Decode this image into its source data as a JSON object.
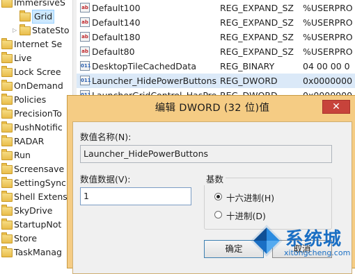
{
  "tree": {
    "items": [
      {
        "label": "ImmersiveS",
        "indent": 0,
        "expander": ""
      },
      {
        "label": "Grid",
        "indent": 1,
        "expander": "",
        "selected": true
      },
      {
        "label": "StateSto",
        "indent": 1,
        "expander": "▷"
      },
      {
        "label": "Internet Se",
        "indent": 0,
        "expander": ""
      },
      {
        "label": "Live",
        "indent": 0,
        "expander": ""
      },
      {
        "label": "Lock Scree",
        "indent": 0,
        "expander": ""
      },
      {
        "label": "OnDemand",
        "indent": 0,
        "expander": ""
      },
      {
        "label": "Policies",
        "indent": 0,
        "expander": ""
      },
      {
        "label": "PrecisionTo",
        "indent": 0,
        "expander": ""
      },
      {
        "label": "PushNotific",
        "indent": 0,
        "expander": ""
      },
      {
        "label": "RADAR",
        "indent": 0,
        "expander": ""
      },
      {
        "label": "Run",
        "indent": 0,
        "expander": ""
      },
      {
        "label": "Screensave",
        "indent": 0,
        "expander": ""
      },
      {
        "label": "SettingSync",
        "indent": 0,
        "expander": ""
      },
      {
        "label": "Shell Extens",
        "indent": 0,
        "expander": ""
      },
      {
        "label": "SkyDrive",
        "indent": 0,
        "expander": ""
      },
      {
        "label": "StartupNot",
        "indent": 0,
        "expander": ""
      },
      {
        "label": "Store",
        "indent": 0,
        "expander": ""
      },
      {
        "label": "TaskManag",
        "indent": 0,
        "expander": ""
      }
    ]
  },
  "values": {
    "rows": [
      {
        "icon": "ab",
        "kind": "sz",
        "name": "Default100",
        "type": "REG_EXPAND_SZ",
        "data": "%USERPRO"
      },
      {
        "icon": "ab",
        "kind": "sz",
        "name": "Default140",
        "type": "REG_EXPAND_SZ",
        "data": "%USERPRO"
      },
      {
        "icon": "ab",
        "kind": "sz",
        "name": "Default180",
        "type": "REG_EXPAND_SZ",
        "data": "%USERPRO"
      },
      {
        "icon": "ab",
        "kind": "sz",
        "name": "Default80",
        "type": "REG_EXPAND_SZ",
        "data": "%USERPRO"
      },
      {
        "icon": "011",
        "kind": "bin",
        "name": "DesktopTileCachedData",
        "type": "REG_BINARY",
        "data": "04 00 00 0"
      },
      {
        "icon": "011",
        "kind": "bin",
        "name": "Launcher_HidePowerButtons",
        "type": "REG_DWORD",
        "data": "0x0000000"
      },
      {
        "icon": "011",
        "kind": "bin",
        "name": "LauncherGridControl_HasPre",
        "type": "REG_DWORD",
        "data": "0x0000000"
      }
    ]
  },
  "dialog": {
    "title": "编辑 DWORD (32 位)值",
    "close_label": "✕",
    "name_label": "数值名称(N):",
    "name_value": "Launcher_HidePowerButtons",
    "data_label": "数值数据(V):",
    "data_value": "1",
    "base_label": "基数",
    "hex_label": "十六进制(H)",
    "dec_label": "十进制(D)",
    "base_selected": "hex",
    "ok_label": "确定",
    "cancel_label": "取消"
  },
  "watermark": {
    "text": "系统城",
    "sub": "xitongcheng.com"
  },
  "colors": {
    "dialog_frame": "#f5cc84",
    "close_button": "#c7433b",
    "selection": "#cce8ff",
    "watermark": "#1a6fc4"
  }
}
